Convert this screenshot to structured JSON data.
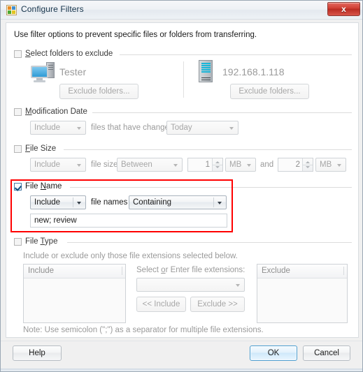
{
  "window": {
    "title": "Configure Filters",
    "icon": "app-icon",
    "close_label": "x"
  },
  "intro": "Use filter options to prevent specific files or folders from transferring.",
  "groups": {
    "folders": {
      "label": "Select folders to exclude",
      "checked": false,
      "local": {
        "name": "Tester",
        "button": "Exclude folders..."
      },
      "remote": {
        "name": "192.168.1.118",
        "button": "Exclude folders..."
      }
    },
    "modification_date": {
      "label": "Modification Date",
      "checked": false,
      "mode": "Include",
      "middle_label": "files that have changed",
      "period": "Today"
    },
    "file_size": {
      "label": "File Size",
      "checked": false,
      "mode": "Include",
      "middle_label": "file size",
      "comparison": "Between",
      "min_value": "1",
      "min_unit": "MB",
      "and_label": "and",
      "max_value": "2",
      "max_unit": "MB"
    },
    "file_name": {
      "label": "File Name",
      "checked": true,
      "mode": "Include",
      "middle_label": "file names",
      "match": "Containing",
      "pattern": "new; review"
    },
    "file_type": {
      "label": "File Type",
      "checked": false,
      "description": "Include or exclude only those file extensions selected below.",
      "include_header": "Include",
      "exclude_header": "Exclude",
      "select_label": "Select or Enter file extensions:",
      "extension_value": "",
      "include_button": "<< Include",
      "exclude_button": "Exclude >>"
    }
  },
  "note": "Note: Use semicolon (\";\") as a separator for multiple file extensions.",
  "footer": {
    "help": "Help",
    "ok": "OK",
    "cancel": "Cancel"
  },
  "colors": {
    "annotation": "#ff0000",
    "close": "#cf3d32",
    "default_button": "#4d9ed0"
  }
}
